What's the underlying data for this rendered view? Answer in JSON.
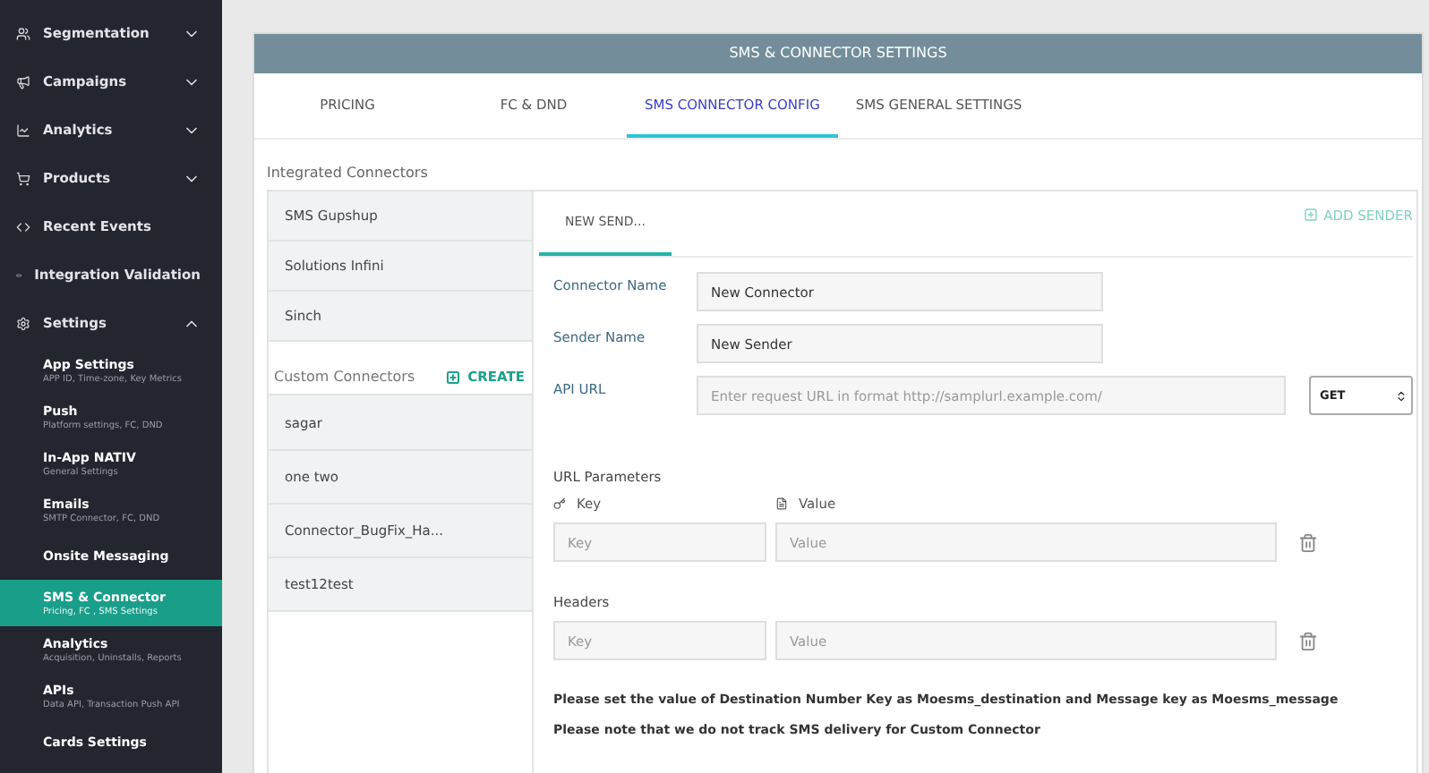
{
  "sidebar": {
    "items": [
      {
        "kind": "menu",
        "label": "Segmentation",
        "expanded": false
      },
      {
        "kind": "menu",
        "label": "Campaigns",
        "expanded": false
      },
      {
        "kind": "menu",
        "label": "Analytics",
        "expanded": false
      },
      {
        "kind": "menu",
        "label": "Products",
        "expanded": false
      },
      {
        "kind": "link",
        "label": "Recent Events"
      },
      {
        "kind": "link",
        "label": "Integration Validation"
      },
      {
        "kind": "menu",
        "label": "Settings",
        "expanded": true,
        "children": [
          {
            "label": "App Settings",
            "subtitle": "APP ID, Time-zone, Key Metrics",
            "selected": false
          },
          {
            "label": "Push",
            "subtitle": "Platform settings, FC, DND",
            "selected": false
          },
          {
            "label": "In-App NATIV",
            "subtitle": "General Settings",
            "selected": false
          },
          {
            "label": "Emails",
            "subtitle": "SMTP Connector, FC, DND",
            "selected": false
          },
          {
            "label": "Onsite Messaging",
            "selected": false
          },
          {
            "label": "SMS & Connector",
            "subtitle": "Pricing, FC , SMS Settings",
            "selected": true
          },
          {
            "label": "Analytics",
            "subtitle": "Acquisition, Uninstalls, Reports",
            "selected": false
          },
          {
            "label": "APIs",
            "subtitle": "Data API, Transaction Push API",
            "selected": false
          },
          {
            "label": "Cards Settings",
            "selected": false
          }
        ]
      }
    ]
  },
  "panel": {
    "title": "SMS & CONNECTOR SETTINGS",
    "tabs": [
      {
        "label": "PRICING",
        "selected": false
      },
      {
        "label": "FC & DND",
        "selected": false
      },
      {
        "label": "SMS CONNECTOR CONFIG",
        "selected": true
      },
      {
        "label": "SMS GENERAL SETTINGS",
        "selected": false
      }
    ],
    "integrated_title": "Integrated Connectors",
    "integrated": [
      {
        "label": "SMS Gupshup",
        "selected": false
      },
      {
        "label": "Solutions Infini",
        "selected": false
      },
      {
        "label": "Sinch",
        "selected": false
      }
    ],
    "custom_title": "Custom Connectors",
    "create_button": "CREATE",
    "custom": [
      {
        "label": "sagar",
        "selected": false
      },
      {
        "label": "one two",
        "selected": false
      },
      {
        "label": "Connector_BugFix_Ha...",
        "selected": false
      },
      {
        "label": "test12test",
        "selected": false
      }
    ],
    "sender_tabs": [
      {
        "label": "NEW SEND...",
        "selected": true
      }
    ],
    "add_sender": "ADD SENDER",
    "form": {
      "connector_name": {
        "label": "Connector Name",
        "value": "New Connector"
      },
      "sender_name": {
        "label": "Sender Name",
        "value": "New Sender"
      },
      "api_url": {
        "label": "API URL",
        "placeholder": "Enter request URL in format http://samplurl.example.com/",
        "method": "GET"
      },
      "url_parameters": {
        "title": "URL Parameters",
        "key_heading": "Key",
        "value_heading": "Value",
        "rows": [
          {
            "key_placeholder": "Key",
            "value_placeholder": "Value"
          }
        ]
      },
      "headers": {
        "title": "Headers",
        "rows": [
          {
            "key_placeholder": "Key",
            "value_placeholder": "Value"
          }
        ]
      },
      "notes": [
        "Please set the value of Destination Number Key as Moesms_destination and Message key as Moesms_message",
        "Please note that we do not track SMS delivery for Custom Connector"
      ]
    }
  }
}
